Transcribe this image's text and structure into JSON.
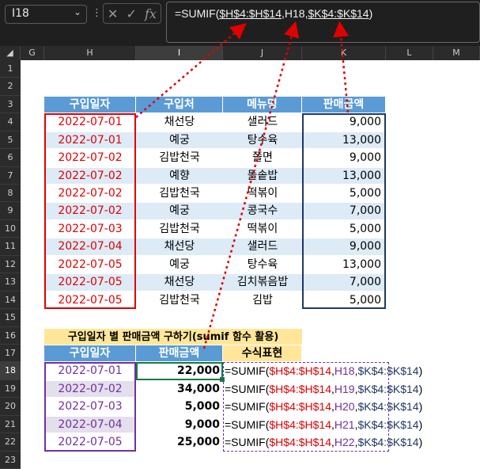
{
  "namebox": {
    "value": "I18"
  },
  "formula_bar": {
    "prefix": "=SUMIF(",
    "arg1": "$H$4:$H$14",
    "sep1": ",",
    "arg2": "H18",
    "sep2": ",",
    "arg3": "$K$4:$K$14",
    "suffix": ")"
  },
  "fx_icons": {
    "cancel": "✕",
    "enter": "✓",
    "fx": "fx"
  },
  "columns": [
    "G",
    "H",
    "I",
    "J",
    "K",
    "L",
    "M"
  ],
  "rows": [
    "1",
    "2",
    "3",
    "4",
    "5",
    "6",
    "7",
    "8",
    "9",
    "10",
    "11",
    "12",
    "13",
    "14",
    "15",
    "16",
    "17",
    "18",
    "19",
    "20",
    "21",
    "22",
    "23"
  ],
  "table1": {
    "headers": [
      "구입일자",
      "구입처",
      "메뉴명",
      "판매금액"
    ],
    "rows": [
      [
        "2022-07-01",
        "채선당",
        "샐러드",
        "9,000"
      ],
      [
        "2022-07-01",
        "예궁",
        "탕수육",
        "13,000"
      ],
      [
        "2022-07-02",
        "김밥천국",
        "쫄면",
        "9,000"
      ],
      [
        "2022-07-02",
        "예향",
        "돌솥밥",
        "13,000"
      ],
      [
        "2022-07-02",
        "김밥천국",
        "떡볶이",
        "5,000"
      ],
      [
        "2022-07-02",
        "예궁",
        "콩국수",
        "7,000"
      ],
      [
        "2022-07-03",
        "김밥천국",
        "떡볶이",
        "5,000"
      ],
      [
        "2022-07-04",
        "채선당",
        "샐러드",
        "9,000"
      ],
      [
        "2022-07-05",
        "예궁",
        "탕수육",
        "13,000"
      ],
      [
        "2022-07-05",
        "채선당",
        "김치볶음밥",
        "7,000"
      ],
      [
        "2022-07-05",
        "김밥천국",
        "김밥",
        "5,000"
      ]
    ]
  },
  "summary": {
    "title": "구입일자 별 판매금액 구하기(sumif 함수 활용)",
    "headers": [
      "구입일자",
      "판매금액",
      "수식표현"
    ],
    "rows": [
      {
        "date": "2022-07-01",
        "amount": "22,000",
        "f_pre": "=SUMIF(",
        "f_r1": "$H$4:$H$14",
        "f_c1": ",",
        "f_r2": "H18",
        "f_c2": ",",
        "f_r3": "$K$4:$K$14",
        "f_end": ")"
      },
      {
        "date": "2022-07-02",
        "amount": "34,000",
        "f_pre": "=SUMIF(",
        "f_r1": "$H$4:$H$14",
        "f_c1": ",",
        "f_r2": "H19",
        "f_c2": ",",
        "f_r3": "$K$4:$K$14",
        "f_end": ")"
      },
      {
        "date": "2022-07-03",
        "amount": "5,000",
        "f_pre": "=SUMIF(",
        "f_r1": "$H$4:$H$14",
        "f_c1": ",",
        "f_r2": "H20",
        "f_c2": ",",
        "f_r3": "$K$4:$K$14",
        "f_end": ")"
      },
      {
        "date": "2022-07-04",
        "amount": "9,000",
        "f_pre": "=SUMIF(",
        "f_r1": "$H$4:$H$14",
        "f_c1": ",",
        "f_r2": "H21",
        "f_c2": ",",
        "f_r3": "$K$4:$K$14",
        "f_end": ")"
      },
      {
        "date": "2022-07-05",
        "amount": "25,000",
        "f_pre": "=SUMIF(",
        "f_r1": "$H$4:$H$14",
        "f_c1": ",",
        "f_r2": "H22",
        "f_c2": ",",
        "f_r3": "$K$4:$K$14",
        "f_end": ")"
      }
    ]
  },
  "colors": {
    "header_blue": "#5b9bd5",
    "band": "#ddebf7",
    "date_red": "#e00000",
    "purple": "#7030a0",
    "navy": "#1f3864",
    "title_yellow": "#ffe699",
    "selected_green": "#107c41"
  }
}
